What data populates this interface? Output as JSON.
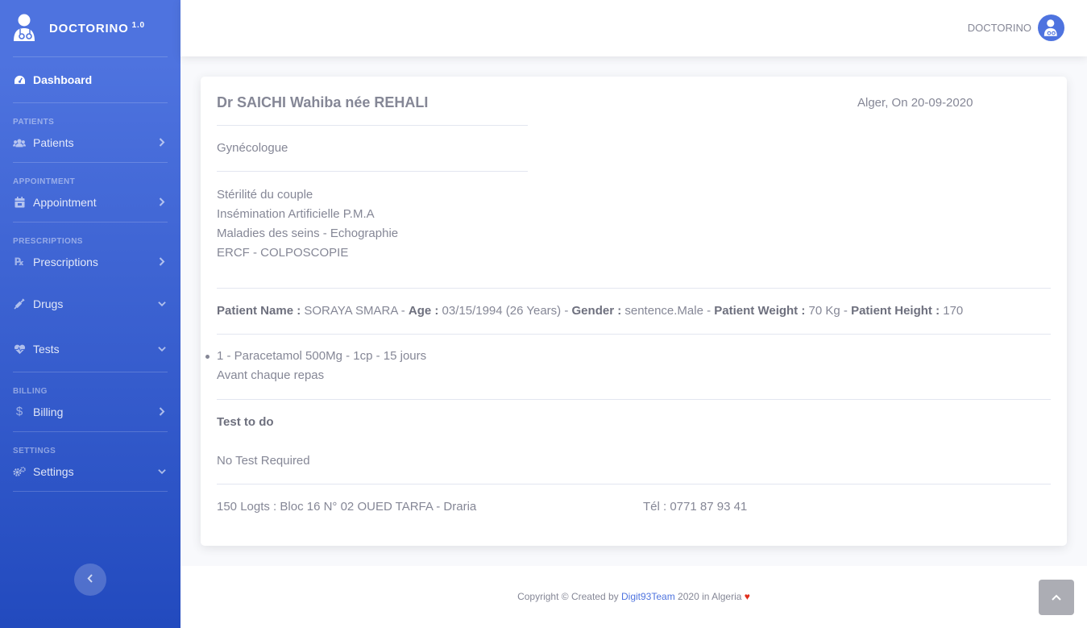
{
  "brand": {
    "name": "DOCTORINO",
    "version": "1.0",
    "icon": "doctor-logo-icon"
  },
  "sidebar": {
    "dashboard": {
      "label": "Dashboard",
      "icon": "tachometer-icon"
    },
    "headings": {
      "patients": "PATIENTS",
      "appointment": "APPOINTMENT",
      "prescriptions": "PRESCRIPTIONS",
      "billing": "BILLING",
      "settings": "SETTINGS"
    },
    "items": {
      "patients": {
        "label": "Patients",
        "icon": "users-icon"
      },
      "appointment": {
        "label": "Appointment",
        "icon": "calendar-icon"
      },
      "prescriptions": {
        "label": "Prescriptions",
        "icon": "prescription-icon"
      },
      "drugs": {
        "label": "Drugs",
        "icon": "syringe-icon"
      },
      "tests": {
        "label": "Tests",
        "icon": "heartbeat-icon"
      },
      "billing": {
        "label": "Billing",
        "icon": "dollar-icon"
      },
      "settings": {
        "label": "Settings",
        "icon": "cogs-icon"
      }
    }
  },
  "topbar": {
    "user_name": "DOCTORINO"
  },
  "prescription": {
    "doctor_name": "Dr SAICHI Wahiba née REHALI",
    "date_line": "Alger, On 20-09-2020",
    "specialty": "Gynécologue",
    "services": [
      "Stérilité du couple",
      "Insémination Artificielle P.M.A",
      "Maladies des seins - Echographie",
      "ERCF - COLPOSCOPIE"
    ],
    "patient": {
      "name_label": "Patient Name :",
      "name": "SORAYA SMARA",
      "age_label": "Age :",
      "age": "03/15/1994 (26 Years)",
      "gender_label": "Gender :",
      "gender": "sentence.Male",
      "weight_label": "Patient Weight :",
      "weight": "70 Kg",
      "height_label": "Patient Height :",
      "height": "170"
    },
    "drugs": [
      {
        "line": "1 - Paracetamol 500Mg - 1cp - 15 jours",
        "note": "Avant chaque repas"
      }
    ],
    "test_title": "Test to do",
    "test_value": "No Test Required",
    "address": "150 Logts : Bloc 16 N° 02 OUED TARFA - Draria",
    "phone": "Tél : 0771 87 93 41"
  },
  "footer": {
    "prefix": "Copyright © Created by",
    "link": "Digit93Team",
    "suffix": "2020 in Algeria"
  },
  "colors": {
    "primary": "#4e73df",
    "primary_dark": "#224abe",
    "text": "#858796",
    "heart": "#e02d1b"
  }
}
